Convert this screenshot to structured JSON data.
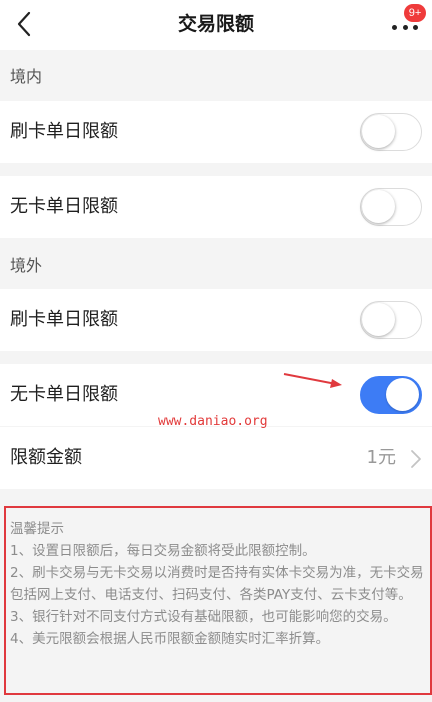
{
  "header": {
    "title": "交易限额",
    "badge": "9+",
    "back_icon": "chevron-left-icon",
    "more_icon": "more-dots-icon"
  },
  "domestic": {
    "label": "境内",
    "card_daily_limit": {
      "label": "刷卡单日限额",
      "enabled": false
    },
    "cardless_daily_limit": {
      "label": "无卡单日限额",
      "enabled": false
    }
  },
  "overseas": {
    "label": "境外",
    "card_daily_limit": {
      "label": "刷卡单日限额",
      "enabled": false
    },
    "cardless_daily_limit": {
      "label": "无卡单日限额",
      "enabled": true
    },
    "limit_amount": {
      "label": "限额金额",
      "value": "1元"
    }
  },
  "watermark": "www.daniao.org",
  "tips": {
    "title": "温馨提示",
    "items": [
      "1、设置日限额后，每日交易金额将受此限额控制。",
      "2、刷卡交易与无卡交易以消费时是否持有实体卡交易为准，无卡交易包括网上支付、电话支付、扫码支付、各类PAY支付、云卡支付等。",
      "3、银行针对不同支付方式设有基础限额，也可能影响您的交易。",
      "4、美元限额会根据人民币限额金额随实时汇率折算。"
    ]
  },
  "colors": {
    "accent": "#3d7cf5",
    "badge": "#ef3b3b",
    "annotation": "#e0393e"
  }
}
